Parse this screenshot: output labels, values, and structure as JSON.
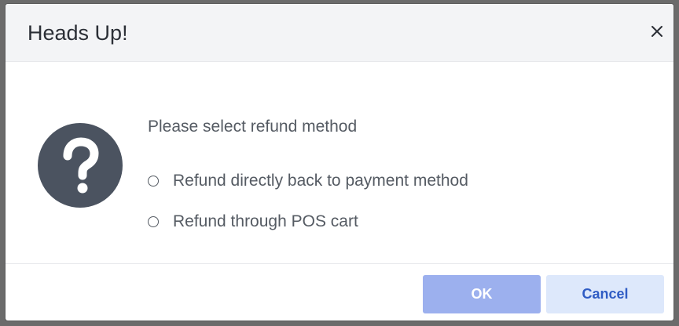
{
  "dialog": {
    "title": "Heads Up!",
    "close_icon": "close-icon",
    "status_icon": "question-mark-icon",
    "prompt": "Please select refund method",
    "options": [
      {
        "label": "Refund directly back to payment method",
        "selected": false
      },
      {
        "label": "Refund through POS cart",
        "selected": false
      }
    ],
    "buttons": {
      "ok_label": "OK",
      "cancel_label": "Cancel"
    }
  },
  "colors": {
    "header_bg": "#f3f4f6",
    "icon_circle": "#4b5360",
    "ok_button_bg": "#9cb0ee",
    "cancel_button_bg": "#dde8fb",
    "cancel_text": "#2f5cc4"
  }
}
